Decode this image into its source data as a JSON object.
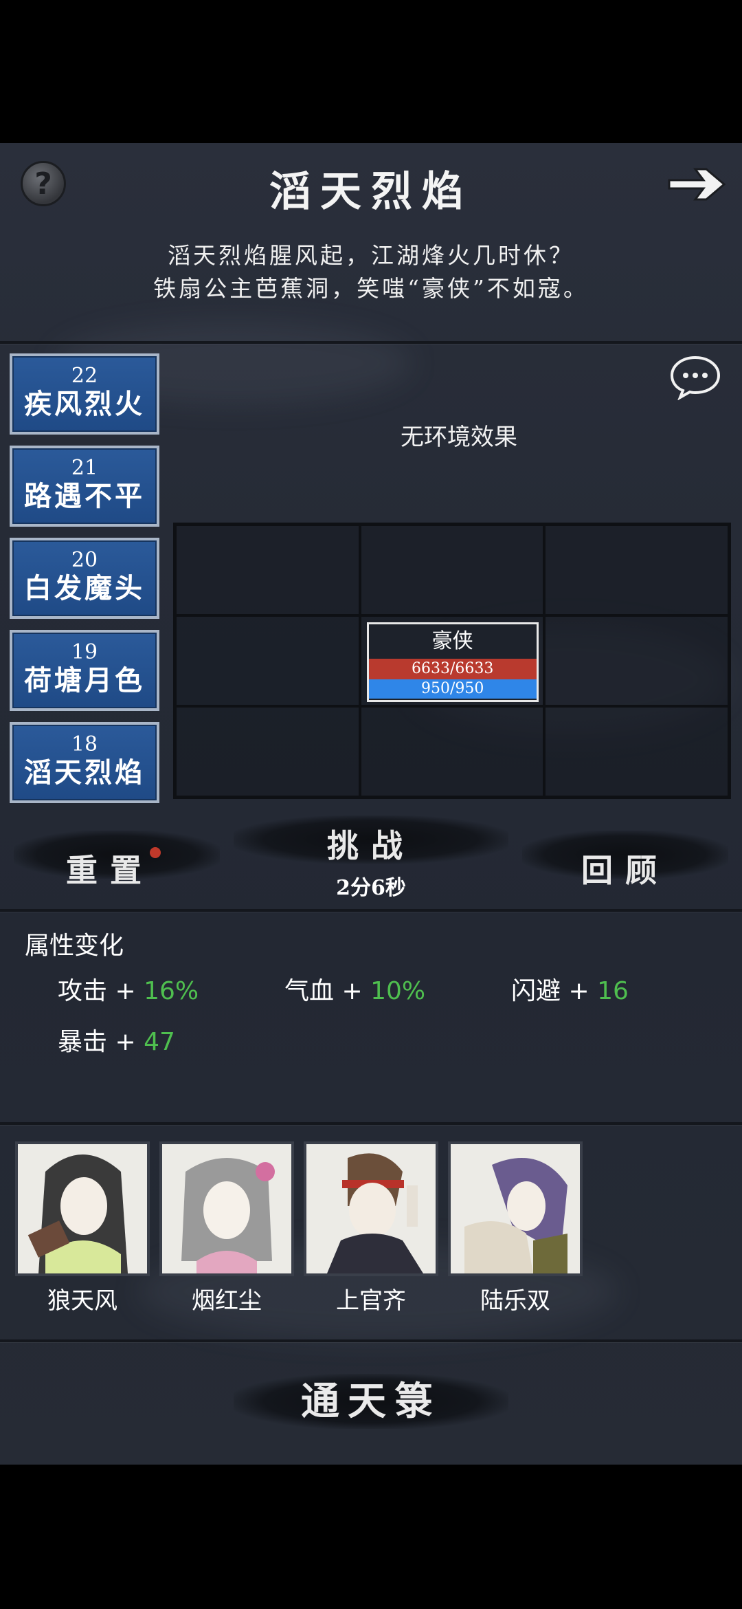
{
  "header": {
    "title": "滔天烈焰",
    "description_line1": "滔天烈焰腥风起，江湖烽火几时休？",
    "description_line2": "铁扇公主芭蕉洞，笑嗤“豪侠”不如寇。"
  },
  "stages": [
    {
      "num": "22",
      "name": "疾风烈火"
    },
    {
      "num": "21",
      "name": "路遇不平"
    },
    {
      "num": "20",
      "name": "白发魔头"
    },
    {
      "num": "19",
      "name": "荷塘月色"
    },
    {
      "num": "18",
      "name": "滔天烈焰"
    }
  ],
  "environment": "无环境效果",
  "unit": {
    "name": "豪侠",
    "hp": "6633/6633",
    "mp": "950/950"
  },
  "actions": {
    "reset": "重置",
    "challenge": "挑战",
    "timer": "2分6秒",
    "review": "回顾"
  },
  "attributes": {
    "title": "属性变化",
    "items": [
      {
        "label": "攻击 + ",
        "value": "16%"
      },
      {
        "label": "气血 + ",
        "value": "10%"
      },
      {
        "label": "闪避 + ",
        "value": "16"
      },
      {
        "label": "暴击 + ",
        "value": "47"
      }
    ]
  },
  "heroes": [
    {
      "name": "狼天风"
    },
    {
      "name": "烟红尘"
    },
    {
      "name": "上官齐"
    },
    {
      "name": "陆乐双"
    }
  ],
  "bottom": {
    "label": "通天箓"
  },
  "colors": {
    "stage_blue": "#1f4a86",
    "hp_red": "#b93a2e",
    "mp_blue": "#2f86e8",
    "bonus_green": "#4fbf4f",
    "background": "#262b36"
  }
}
